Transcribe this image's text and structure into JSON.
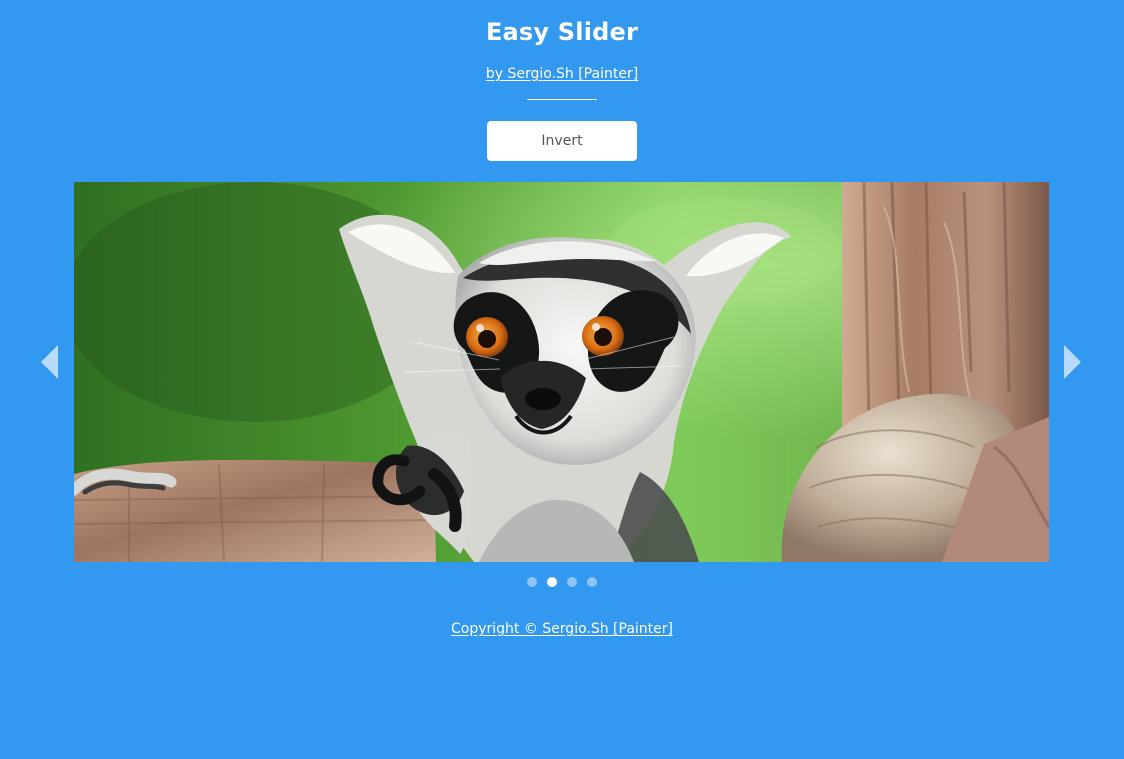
{
  "header": {
    "title": "Easy Slider",
    "byline": "by Sergio.Sh [Painter]"
  },
  "controls": {
    "invert_label": "Invert"
  },
  "slider": {
    "current_index": 1,
    "slide_count": 4,
    "dot_active": [
      false,
      true,
      false,
      false
    ],
    "arrow_icons": [
      "chevron-left-icon",
      "chevron-right-icon"
    ]
  },
  "footer": {
    "copyright": "Copyright © Sergio.Sh [Painter]"
  },
  "colors": {
    "background": "#3399f0",
    "text": "#ffffff",
    "button_text": "#555555",
    "dot_inactive": "#8cc6f7",
    "dot_active": "#ffffff",
    "arrow": "#b8dbfb"
  }
}
